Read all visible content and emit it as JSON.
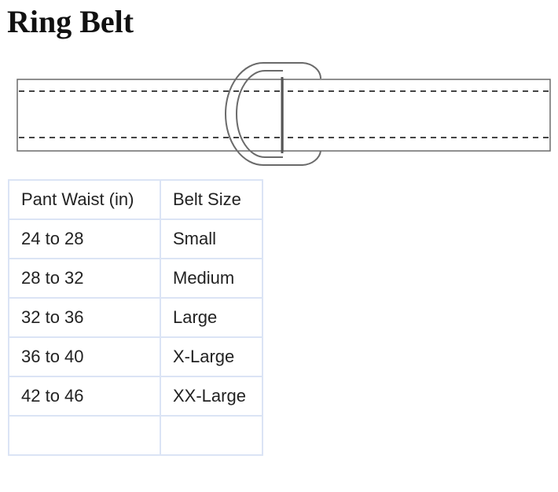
{
  "page": {
    "title": "Ring Belt"
  },
  "illustration": {
    "icon": "ring-belt-icon",
    "stroke_color": "#555555",
    "dash_color": "#444444"
  },
  "size_chart": {
    "border_color": "#dbe4f5",
    "header": {
      "waist": "Pant Waist (in)",
      "size": "Belt Size"
    },
    "rows": [
      {
        "waist": "24 to 28",
        "size": "Small"
      },
      {
        "waist": "28 to 32",
        "size": "Medium"
      },
      {
        "waist": "32 to 36",
        "size": "Large"
      },
      {
        "waist": "36 to 40",
        "size": "X-Large"
      },
      {
        "waist": "42 to 46",
        "size": "XX-Large"
      },
      {
        "waist": "",
        "size": ""
      }
    ]
  }
}
